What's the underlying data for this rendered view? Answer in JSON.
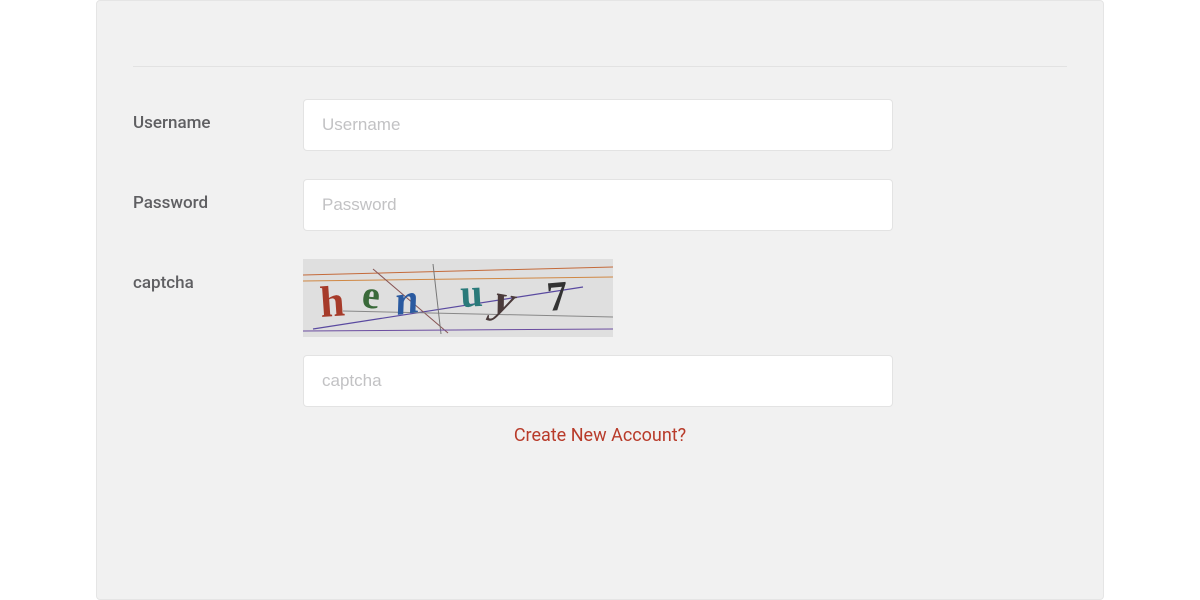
{
  "form": {
    "username": {
      "label": "Username",
      "placeholder": "Username",
      "value": ""
    },
    "password": {
      "label": "Password",
      "placeholder": "Password",
      "value": ""
    },
    "captcha": {
      "label": "captcha",
      "placeholder": "captcha",
      "value": "",
      "image_text": "henuy7"
    }
  },
  "links": {
    "create_account": "Create New Account?"
  }
}
